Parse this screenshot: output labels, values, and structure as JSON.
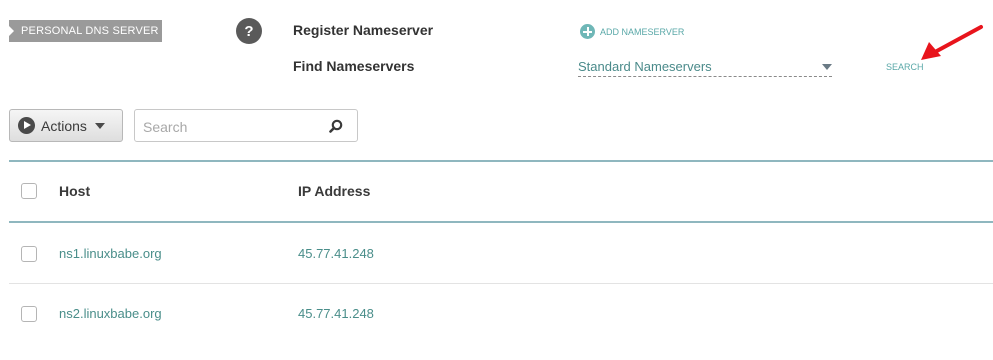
{
  "section_tag": "PERSONAL DNS SERVER",
  "help_glyph": "?",
  "register": {
    "label": "Register Nameserver",
    "add_label": "ADD NAMESERVER"
  },
  "find": {
    "label": "Find Nameservers",
    "selected": "Standard Nameservers",
    "search_label": "SEARCH"
  },
  "toolbar": {
    "actions_label": "Actions",
    "search_placeholder": "Search"
  },
  "table": {
    "columns": [
      "Host",
      "IP Address"
    ],
    "rows": [
      {
        "host": "ns1.linuxbabe.org",
        "ip": "45.77.41.248"
      },
      {
        "host": "ns2.linuxbabe.org",
        "ip": "45.77.41.248"
      }
    ]
  },
  "colors": {
    "accent_teal": "#5aa8a8",
    "annotation_red": "#e8141c",
    "tag_gray": "#9a9a9a"
  },
  "icons": {
    "help": "question-mark-icon",
    "add": "plus-circle-icon",
    "dropdown": "caret-down-icon",
    "actions": "play-circle-icon",
    "search": "magnifier-icon",
    "annotation": "red-arrow-icon"
  }
}
